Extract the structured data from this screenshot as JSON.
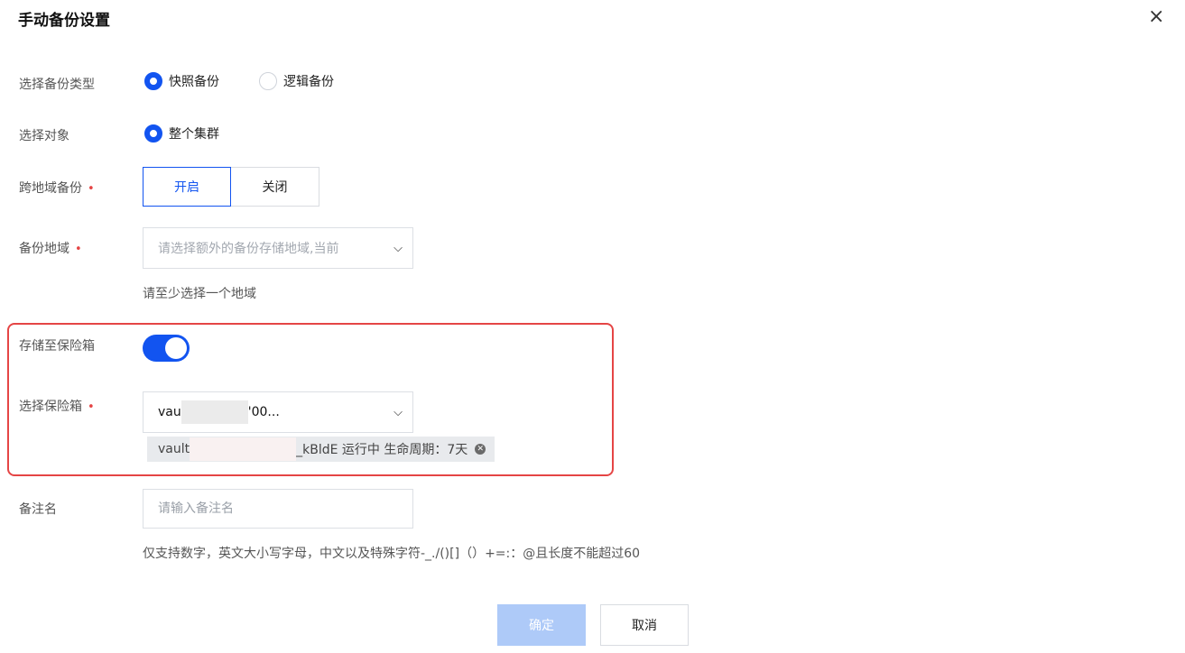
{
  "dialog": {
    "title": "手动备份设置",
    "close_symbol": "×"
  },
  "backup_type": {
    "label": "选择备份类型",
    "options": [
      "快照备份",
      "逻辑备份"
    ],
    "selected": "快照备份"
  },
  "target": {
    "label": "选择对象",
    "options": [
      "整个集群"
    ],
    "selected": "整个集群"
  },
  "cross_region": {
    "label": "跨地域备份",
    "required_mark": "•",
    "options": [
      "开启",
      "关闭"
    ],
    "selected": "开启"
  },
  "region": {
    "label": "备份地域",
    "required_mark": "•",
    "placeholder": "请选择额外的备份存储地域,当前",
    "hint": "请至少选择一个地域"
  },
  "vault_store": {
    "label": "存储至保险箱",
    "enabled": true
  },
  "vault_select": {
    "label": "选择保险箱",
    "required_mark": "•",
    "value_prefix": "vau",
    "value_suffix": "'00...",
    "tag": {
      "prefix": "vault",
      "suffix": "_kBldE 运行中 生命周期：7天"
    }
  },
  "remark": {
    "label": "备注名",
    "placeholder": "请输入备注名",
    "hint": "仅支持数字，英文大小写字母，中文以及特殊字符-_./()[]（）+=:：@且长度不能超过60"
  },
  "actions": {
    "confirm": "确定",
    "cancel": "取消"
  },
  "colors": {
    "accent": "#1254f0",
    "required": "#e54545",
    "highlight_border": "#e54545",
    "confirm_disabled": "#aecaf8"
  }
}
